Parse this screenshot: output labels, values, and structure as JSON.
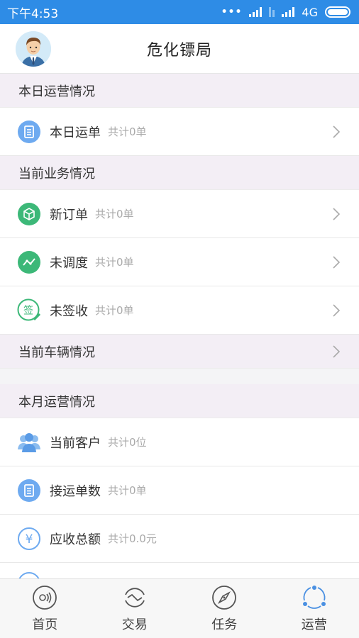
{
  "status_bar": {
    "time": "下午4:53",
    "dots": "•••",
    "network": "4G"
  },
  "header": {
    "title": "危化镖局"
  },
  "sections": {
    "today_ops": {
      "title": "本日运营情况",
      "items": [
        {
          "label": "本日运单",
          "count": "共计0单",
          "icon": "document-icon"
        }
      ]
    },
    "current_business": {
      "title": "当前业务情况",
      "items": [
        {
          "label": "新订单",
          "count": "共计0单",
          "icon": "box-icon"
        },
        {
          "label": "未调度",
          "count": "共计0单",
          "icon": "trend-icon"
        },
        {
          "label": "未签收",
          "count": "共计0单",
          "icon": "sign-icon"
        }
      ]
    },
    "vehicles": {
      "title": "当前车辆情况"
    },
    "month_ops": {
      "title": "本月运营情况",
      "items": [
        {
          "label": "当前客户",
          "count": "共计0位",
          "icon": "customers-icon"
        },
        {
          "label": "接运单数",
          "count": "共计0单",
          "icon": "document-icon"
        },
        {
          "label": "应收总额",
          "count": "共计0.0元",
          "icon": "yuan-icon"
        }
      ]
    }
  },
  "tabs": [
    {
      "label": "首页",
      "icon": "home-icon"
    },
    {
      "label": "交易",
      "icon": "exchange-icon"
    },
    {
      "label": "任务",
      "icon": "compass-icon"
    },
    {
      "label": "运营",
      "icon": "operations-icon"
    }
  ],
  "colors": {
    "status_bar": "#2e8ce6",
    "blue_icon": "#6eaaf0",
    "green_icon": "#3cb878",
    "section_bg": "#f3eef5"
  },
  "icon_text": {
    "sign": "签",
    "yuan": "¥"
  }
}
